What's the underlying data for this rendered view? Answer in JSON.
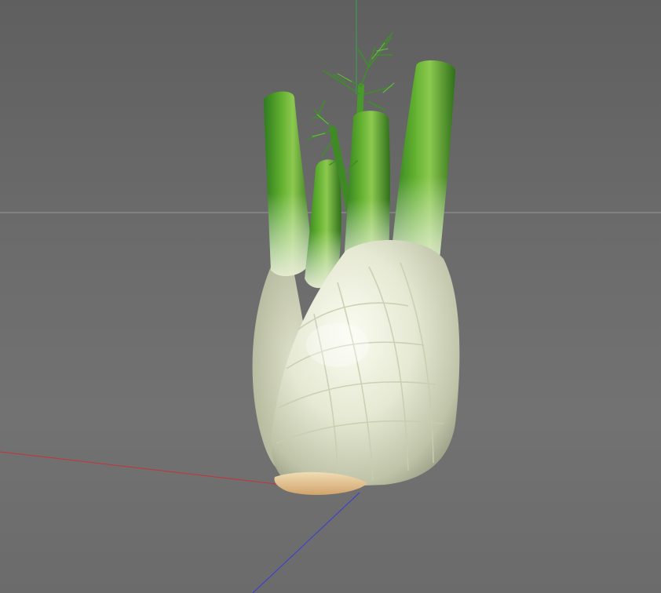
{
  "viewport": {
    "background_color": "#6b6b6b",
    "axes": {
      "x_axis_color": "#c8323a",
      "y_axis_color": "#2fa84f",
      "z_axis_color": "#3a3ad8",
      "horizon_color": "#9a9a9a"
    },
    "object": {
      "name": "fennel-bulb",
      "colors": {
        "stalk_dark": "#2f7a1f",
        "stalk_mid": "#5fae2e",
        "stalk_light": "#a9d36b",
        "bulb_light": "#f2f3e6",
        "bulb_mid": "#d9dcc4",
        "bulb_shadow": "#9fa48a",
        "root": "#e8c89a"
      }
    }
  }
}
